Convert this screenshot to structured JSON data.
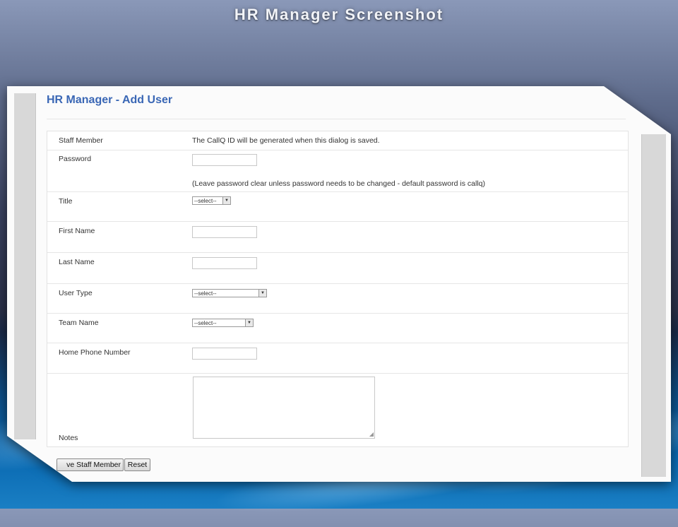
{
  "slide": {
    "title": "HR Manager Screenshot"
  },
  "page": {
    "title": "HR Manager - Add User"
  },
  "form": {
    "staff_member": {
      "label": "Staff Member",
      "value": "The CallQ ID will be generated when this dialog is saved."
    },
    "password": {
      "label": "Password",
      "value": "",
      "hint": "(Leave password clear unless password needs to be changed - default password is callq)"
    },
    "title": {
      "label": "Title",
      "selected": "--select--"
    },
    "first_name": {
      "label": "First Name",
      "value": ""
    },
    "last_name": {
      "label": "Last Name",
      "value": ""
    },
    "user_type": {
      "label": "User Type",
      "selected": "--select--"
    },
    "team_name": {
      "label": "Team Name",
      "selected": "--select--"
    },
    "home_phone": {
      "label": "Home Phone Number",
      "value": ""
    },
    "notes": {
      "label": "Notes",
      "value": ""
    }
  },
  "buttons": {
    "save_label": "ve Staff Member",
    "reset_label": "Reset"
  },
  "icons": {
    "select_arrow": "chevron-down-icon",
    "resize": "resize-grip-icon"
  }
}
